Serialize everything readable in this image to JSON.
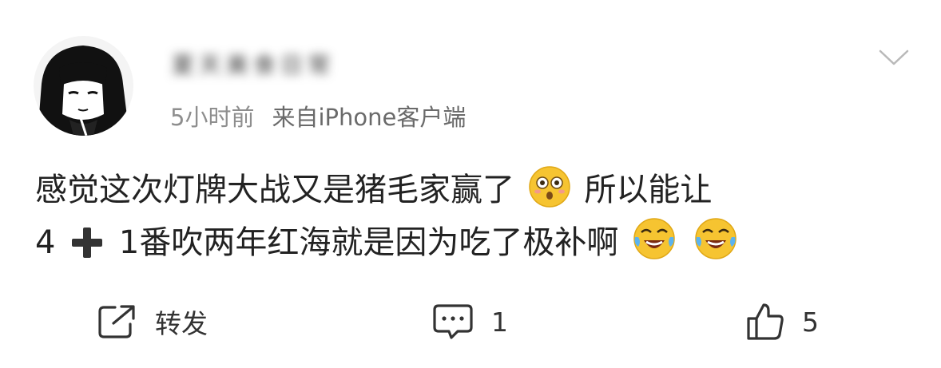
{
  "post": {
    "username": "夏天美食日常",
    "time": "5小时前",
    "source": "来自iPhone客户端",
    "content_line1_a": "感觉这次灯牌大战又是猪毛家赢了",
    "content_line1_b": "所以能让",
    "content_line2_a": "4",
    "content_line2_b": "1番吹两年红海就是因为吃了极补啊"
  },
  "emojis": [
    "flushed-face-emoji",
    "plus-emoji",
    "laughing-crying-emoji",
    "laughing-crying-emoji"
  ],
  "actions": {
    "repost_label": "转发",
    "comment_count": "1",
    "like_count": "5"
  },
  "colors": {
    "text": "#222222",
    "meta": "#8e8e8e",
    "icon": "#333333",
    "emoji_yellow": "#f6c431"
  }
}
